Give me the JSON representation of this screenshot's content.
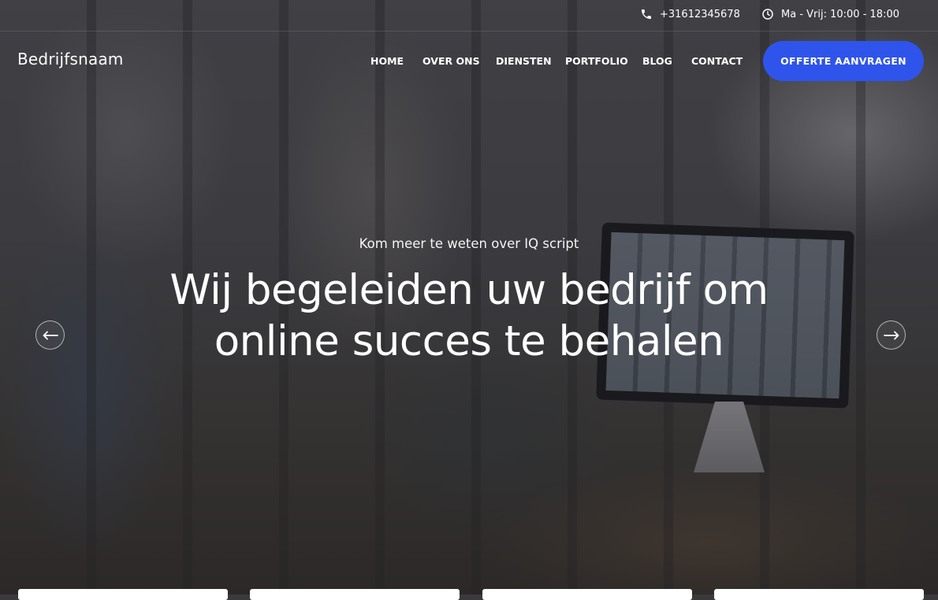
{
  "topbar": {
    "phone": "+31612345678",
    "phone_icon": "phone-icon",
    "hours": "Ma - Vrij: 10:00 - 18:00",
    "hours_icon": "clock-icon"
  },
  "header": {
    "logo": "Bedrijfsnaam",
    "nav": [
      {
        "label": "HOME"
      },
      {
        "label": "OVER ONS"
      },
      {
        "label": "DIENSTEN"
      },
      {
        "label": "PORTFOLIO"
      },
      {
        "label": "BLOG"
      },
      {
        "label": "CONTACT"
      }
    ],
    "cta_label": "OFFERTE AANVRAGEN"
  },
  "hero": {
    "kicker": "Kom meer te weten over IQ script",
    "headline_line1": "Wij begeleiden uw bedrijf om",
    "headline_line2": "online succes te behalen",
    "prev_icon": "arrow-left-icon",
    "next_icon": "arrow-right-icon"
  },
  "colors": {
    "accent": "#2f54eb",
    "text": "#ffffff"
  }
}
